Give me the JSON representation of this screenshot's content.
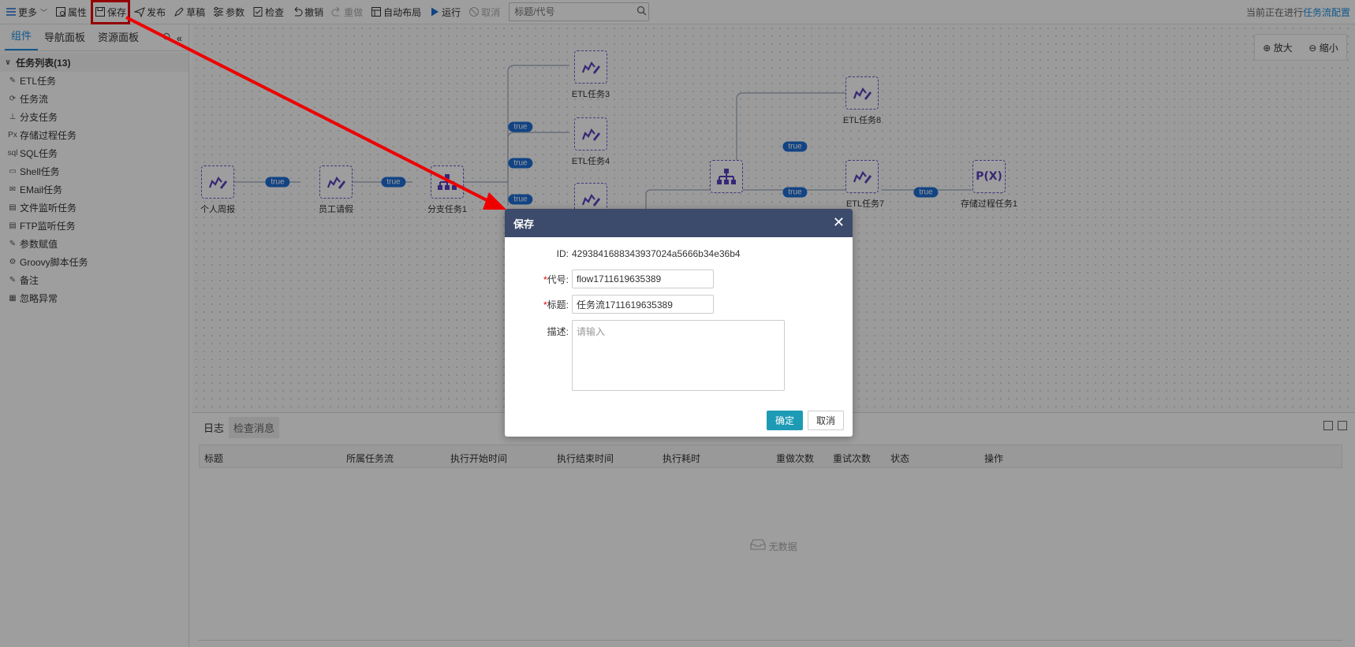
{
  "toolbar": {
    "more": "更多",
    "props": "属性",
    "save": "保存",
    "publish": "发布",
    "draft": "草稿",
    "params": "参数",
    "check": "检查",
    "undo": "撤销",
    "redo": "重做",
    "autolayout": "自动布局",
    "run": "运行",
    "cancel": "取消",
    "search_placeholder": "标题/代号",
    "status_prefix": "当前正在进行",
    "status_accent": "任务流配置"
  },
  "left": {
    "tabs": [
      "组件",
      "导航面板",
      "资源面板"
    ],
    "tree_title": "任务列表(13)",
    "items": [
      "ETL任务",
      "任务流",
      "分支任务",
      "存储过程任务",
      "SQL任务",
      "Shell任务",
      "EMail任务",
      "文件监听任务",
      "FTP监听任务",
      "参数赋值",
      "Groovy脚本任务",
      "备注",
      "忽略异常"
    ],
    "item_icons": [
      "etl-icon",
      "flow-icon",
      "branch-icon",
      "proc-icon",
      "sql-icon",
      "shell-icon",
      "email-icon",
      "file-watch-icon",
      "ftp-icon",
      "assign-icon",
      "groovy-icon",
      "note-icon",
      "ignore-icon"
    ]
  },
  "canvas": {
    "zoom_in": "放大",
    "zoom_out": "缩小",
    "nodes": {
      "n1": "个人周报",
      "n2": "员工请假",
      "n3": "分支任务1",
      "n4": "ETL任务3",
      "n5": "ETL任务4",
      "n6": "ETL任务8",
      "n7": "ETL任务7",
      "n8": "存储过程任务1",
      "pfx_text": "P(X)"
    },
    "edge_label": "true"
  },
  "bottom": {
    "tabs": [
      "日志",
      "检查消息"
    ],
    "columns": [
      "标题",
      "所属任务流",
      "执行开始时间",
      "执行结束时间",
      "执行耗时",
      "重做次数",
      "重试次数",
      "状态",
      "操作"
    ],
    "empty": "无数据"
  },
  "dialog": {
    "title": "保存",
    "id_label": "ID:",
    "id_value": "4293841688343937024a5666b34e36b4",
    "code_label": "代号:",
    "code_value": "flow1711619635389",
    "title_label": "标题:",
    "title_value": "任务流1711619635389",
    "desc_label": "描述:",
    "desc_placeholder": "请输入",
    "ok": "确定",
    "cancel": "取消"
  },
  "colors": {
    "accent": "#1d8fe0",
    "dialog_header": "#3c4b6b",
    "ok_button": "#1d9bb5",
    "annotation": "#ee0000",
    "edge_pill": "#1d6fd6",
    "node_border": "#6a5acd"
  }
}
